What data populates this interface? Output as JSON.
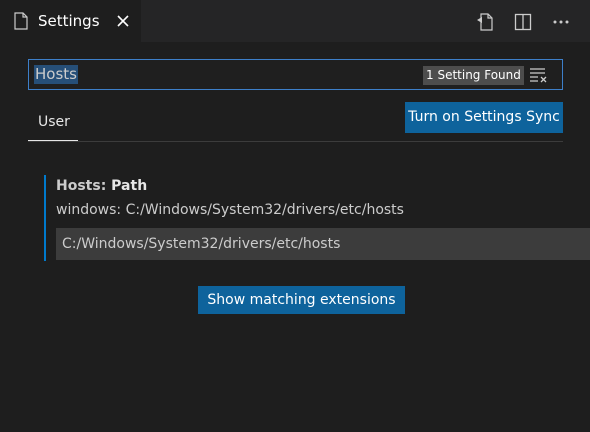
{
  "tab": {
    "label": "Settings",
    "icon": "file-icon",
    "close_icon": "close-icon"
  },
  "actions": [
    {
      "icon": "open-settings-json-icon"
    },
    {
      "icon": "split-editor-icon"
    },
    {
      "icon": "more-actions-icon"
    }
  ],
  "search": {
    "value": "Hosts",
    "results": "1 Setting Found",
    "filter_icon": "clear-filter-icon"
  },
  "scope": {
    "tab_label": "User"
  },
  "sync_button": {
    "label": "Turn on Settings Sync"
  },
  "setting": {
    "category": "Hosts: ",
    "name": "Path",
    "description": "windows: C:/Windows/System32/drivers/etc/hosts",
    "value": "C:/Windows/System32/drivers/etc/hosts"
  },
  "extensions_button": {
    "label": "Show matching extensions"
  },
  "colors": {
    "accent": "#007acc",
    "button": "#0e639c",
    "focus_border": "#3d7fc9",
    "background": "#1e1e1e"
  }
}
